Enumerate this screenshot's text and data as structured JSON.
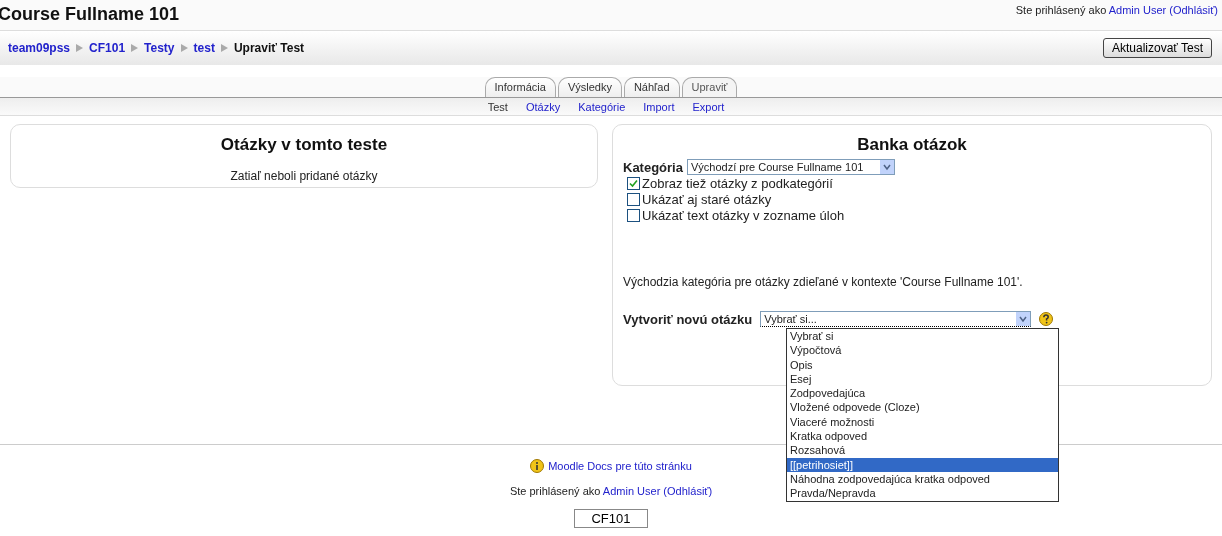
{
  "header": {
    "title": "Course Fullname 101",
    "login_text": "Ste prihlásený ako",
    "login_user": "Admin User",
    "logout": "(Odhlásiť)"
  },
  "breadcrumb": {
    "items": [
      {
        "label": "team09pss",
        "kind": "link"
      },
      {
        "label": "CF101",
        "kind": "link"
      },
      {
        "label": "Testy",
        "kind": "link"
      },
      {
        "label": "test",
        "kind": "link"
      },
      {
        "label": "Upraviť Test",
        "kind": "current"
      }
    ],
    "button": "Aktualizovať Test"
  },
  "tabs": [
    {
      "label": "Informácia",
      "selected": false
    },
    {
      "label": "Výsledky",
      "selected": false
    },
    {
      "label": "Náhľad",
      "selected": false
    },
    {
      "label": "Upraviť",
      "selected": true
    }
  ],
  "subtabs": [
    {
      "label": "Test",
      "selected": true
    },
    {
      "label": "Otázky",
      "selected": false
    },
    {
      "label": "Kategórie",
      "selected": false
    },
    {
      "label": "Import",
      "selected": false
    },
    {
      "label": "Export",
      "selected": false
    }
  ],
  "left_panel": {
    "title": "Otázky v tomto teste",
    "message": "Zatiaľ neboli pridané otázky"
  },
  "right_panel": {
    "title": "Banka otázok",
    "category_label": "Kategória",
    "category_value": "Východzí pre Course Fullname 101",
    "checkboxes": [
      {
        "label": "Zobraz tiež otázky z podkategórií",
        "checked": true
      },
      {
        "label": "Ukázať aj staré otázky",
        "checked": false
      },
      {
        "label": "Ukázať text otázky v zozname úloh",
        "checked": false
      }
    ],
    "info": "Východzia kategória pre otázky zdieľané v kontexte 'Course Fullname 101'.",
    "create_label": "Vytvoriť novú otázku",
    "create_value": "Vybrať si...",
    "options": [
      {
        "label": "Vybrať si",
        "selected": false
      },
      {
        "label": "Výpočtová",
        "selected": false
      },
      {
        "label": "Opis",
        "selected": false
      },
      {
        "label": "Esej",
        "selected": false
      },
      {
        "label": "Zodpovedajúca",
        "selected": false
      },
      {
        "label": "Vložené odpovede (Cloze)",
        "selected": false
      },
      {
        "label": "Viaceré možnosti",
        "selected": false
      },
      {
        "label": "Kratka odpoved",
        "selected": false
      },
      {
        "label": "Rozsahová",
        "selected": false
      },
      {
        "label": "[[petrihosiet]]",
        "selected": true
      },
      {
        "label": "Náhodna zodpovedajúca kratka odpoved",
        "selected": false
      },
      {
        "label": "Pravda/Nepravda",
        "selected": false
      }
    ]
  },
  "footer": {
    "docs_link": "Moodle Docs pre túto stránku",
    "login_text": "Ste prihlásený ako",
    "login_user": "Admin User",
    "logout": "(Odhlásiť)",
    "course_button": "CF101"
  }
}
